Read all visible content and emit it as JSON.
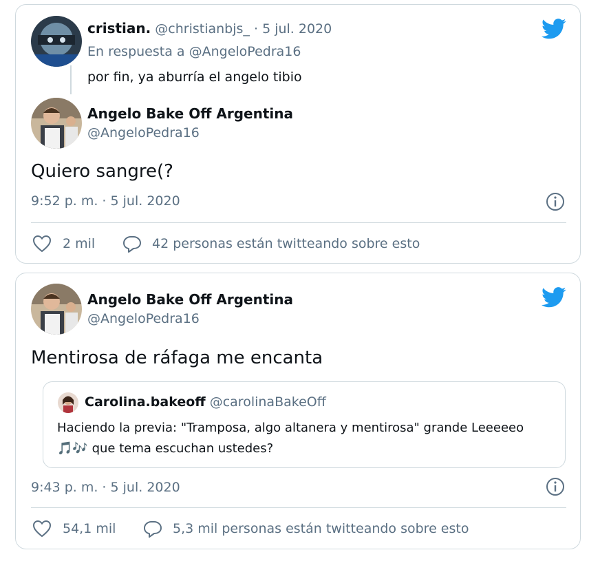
{
  "tweet1": {
    "reply": {
      "name": "cristian.",
      "handle": "@christianbjs_",
      "dot": "·",
      "date": "5 jul. 2020",
      "in_reply_prefix": "En respuesta a",
      "in_reply_handle": "@AngeloPedra16",
      "text": "por fin, ya aburría el angelo tibio"
    },
    "main": {
      "name": "Angelo Bake Off Argentina",
      "handle": "@AngeloPedra16",
      "text": "Quiero sangre(?",
      "timestamp": "9:52 p. m. · 5 jul. 2020",
      "likes": "2 mil",
      "conversation": "42 personas están twitteando sobre esto"
    }
  },
  "tweet2": {
    "name": "Angelo Bake Off Argentina",
    "handle": "@AngeloPedra16",
    "text": "Mentirosa de ráfaga me encanta",
    "quote": {
      "name": "Carolina.bakeoff",
      "handle": "@carolinaBakeOff",
      "line1": "Haciendo la previa: \"Tramposa, algo altanera y mentirosa\" grande Leeeeeo",
      "emoji": "🎵🎶",
      "line2": "que tema escuchan ustedes?"
    },
    "timestamp": "9:43 p. m. · 5 jul. 2020",
    "likes": "54,1 mil",
    "conversation": "5,3 mil personas están twitteando sobre esto"
  },
  "icons": {
    "brand": "twitter-bird-icon",
    "like": "heart-icon",
    "reply": "comment-bubble-icon",
    "info": "info-icon"
  },
  "colors": {
    "brand_blue": "#1d9bf0",
    "muted": "#5b7083",
    "border": "#cfd9de"
  }
}
